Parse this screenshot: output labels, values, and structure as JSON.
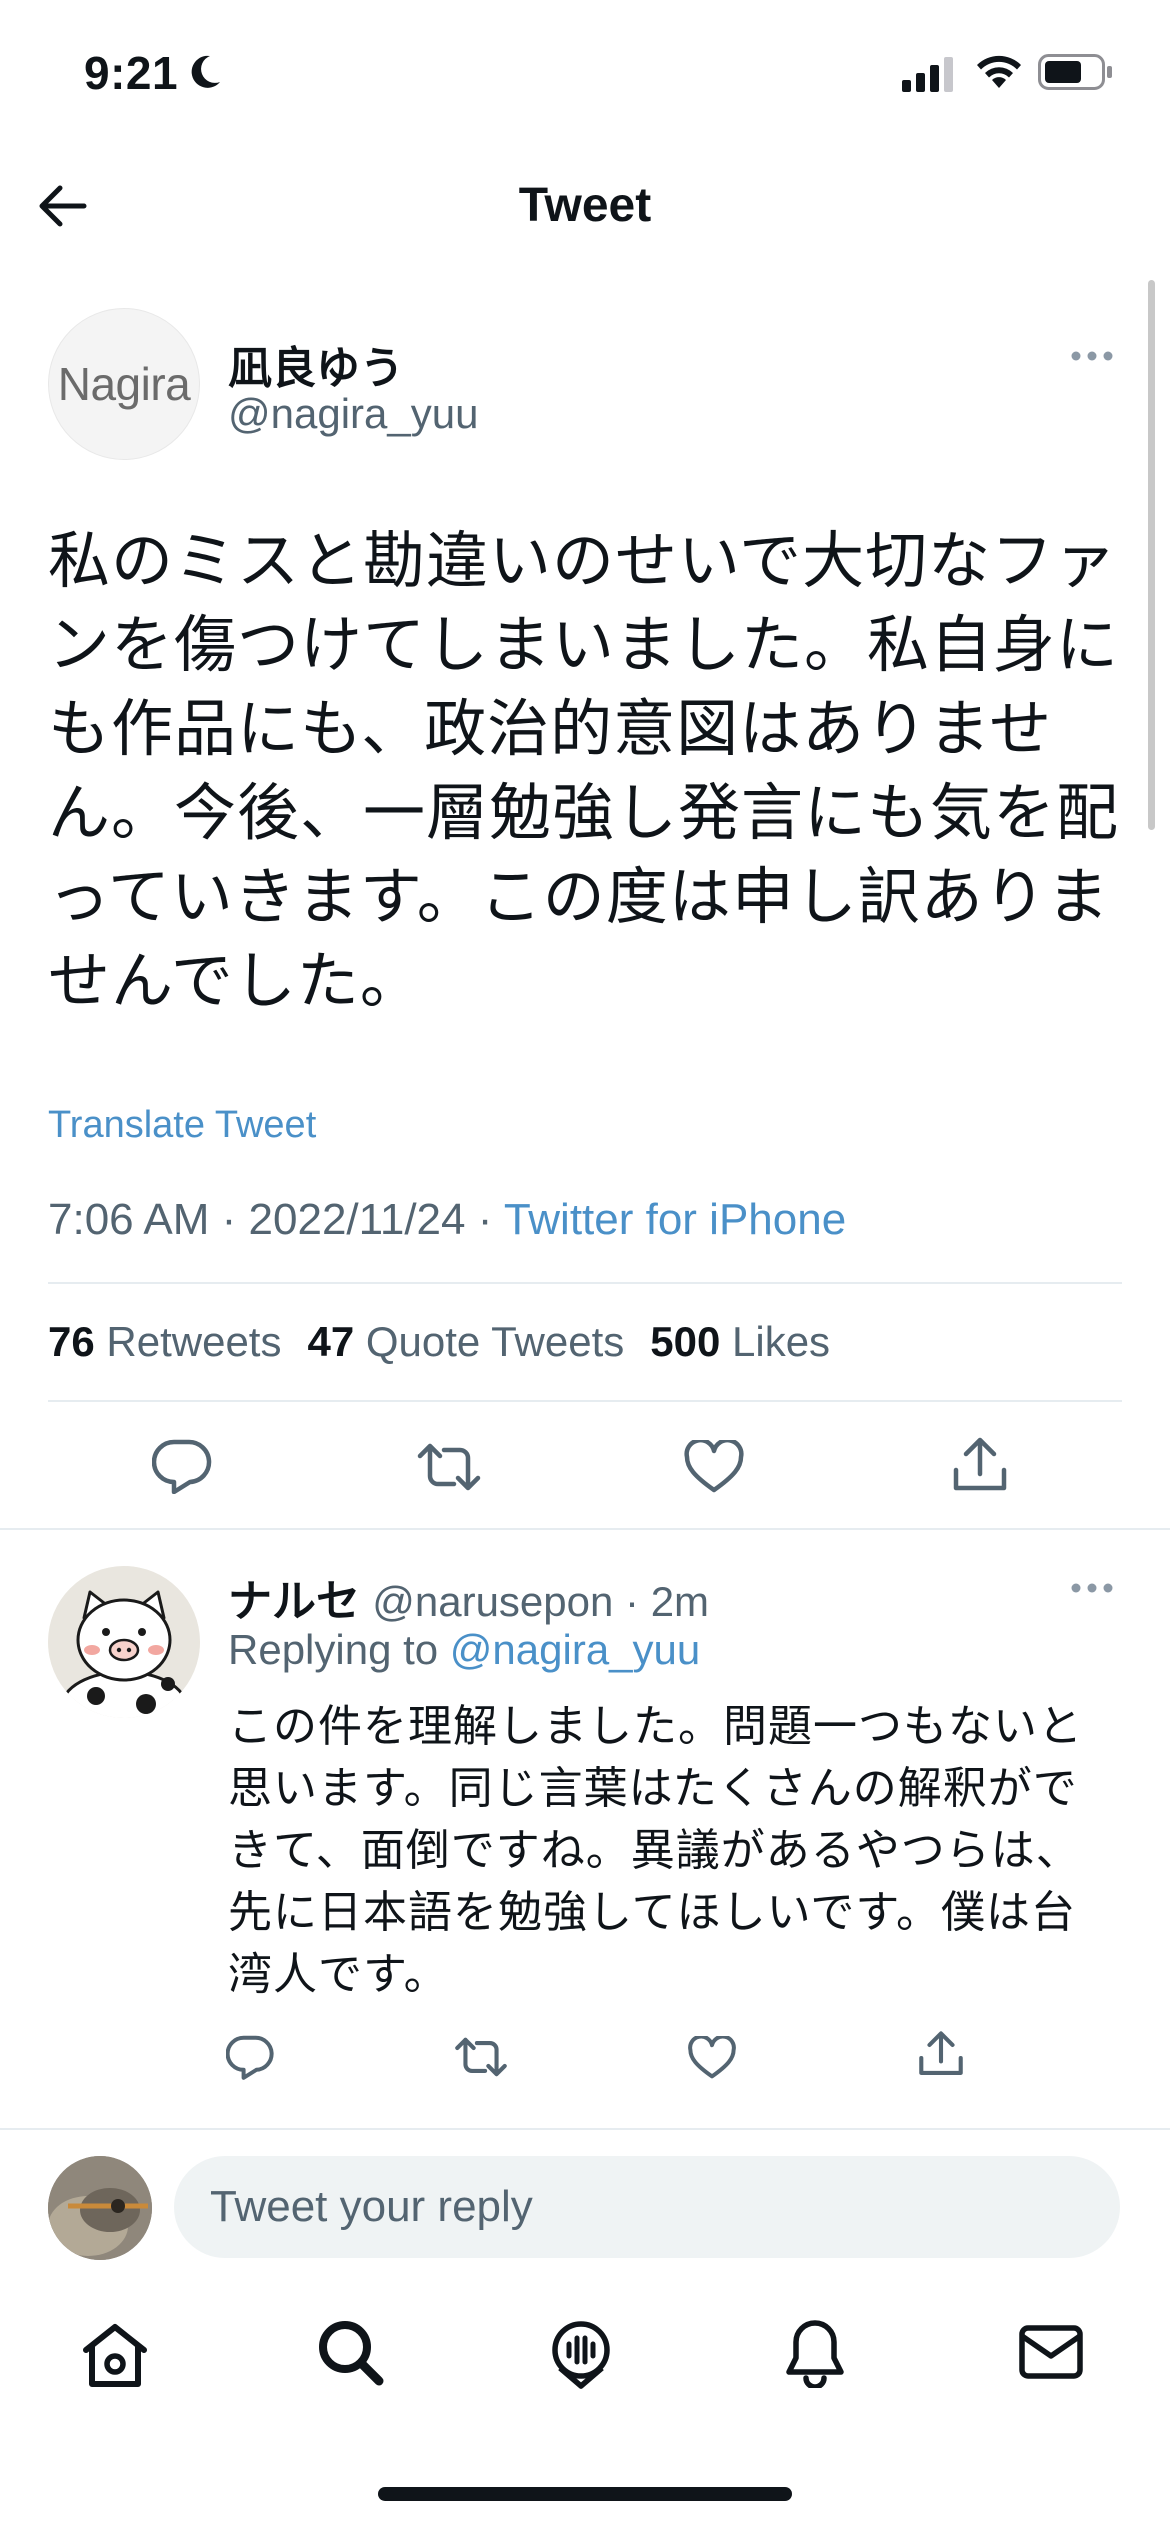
{
  "status_bar": {
    "time": "9:21"
  },
  "header": {
    "title": "Tweet"
  },
  "tweet": {
    "author_name": "凪良ゆう",
    "author_handle": "@nagira_yuu",
    "avatar_text": "Nagira",
    "text": "私のミスと勘違いのせいで大切なファンを傷つけてしまいました。私自身にも作品にも、政治的意図はありません。今後、一層勉強し発言にも気を配っていきます。この度は申し訳ありませんでした。",
    "translate_label": "Translate Tweet",
    "time": "7:06 AM",
    "date": "2022/11/24",
    "source": "Twitter for iPhone",
    "retweets_count": "76",
    "retweets_label": "Retweets",
    "quotes_count": "47",
    "quotes_label": "Quote Tweets",
    "likes_count": "500",
    "likes_label": "Likes"
  },
  "reply": {
    "name": "ナルセ",
    "handle": "@narusepon",
    "age": "2m",
    "replying_label": "Replying to",
    "replying_to": "@nagira_yuu",
    "text": "この件を理解しました。問題一つもないと思います。同じ言葉はたくさんの解釈ができて、面倒ですね。異議があるやつらは、先に日本語を勉強してほしいです。僕は台湾人です。"
  },
  "reply_box": {
    "placeholder": "Tweet your reply"
  },
  "icons": {
    "nav": [
      "home-icon",
      "search-icon",
      "spaces-icon",
      "notifications-icon",
      "messages-icon"
    ],
    "actions": [
      "reply-icon",
      "retweet-icon",
      "like-icon",
      "share-icon"
    ]
  },
  "colors": {
    "link": "#4a90c8",
    "secondary_text": "#536471",
    "divider": "#e6ecf0",
    "input_bg": "#eff3f4"
  }
}
